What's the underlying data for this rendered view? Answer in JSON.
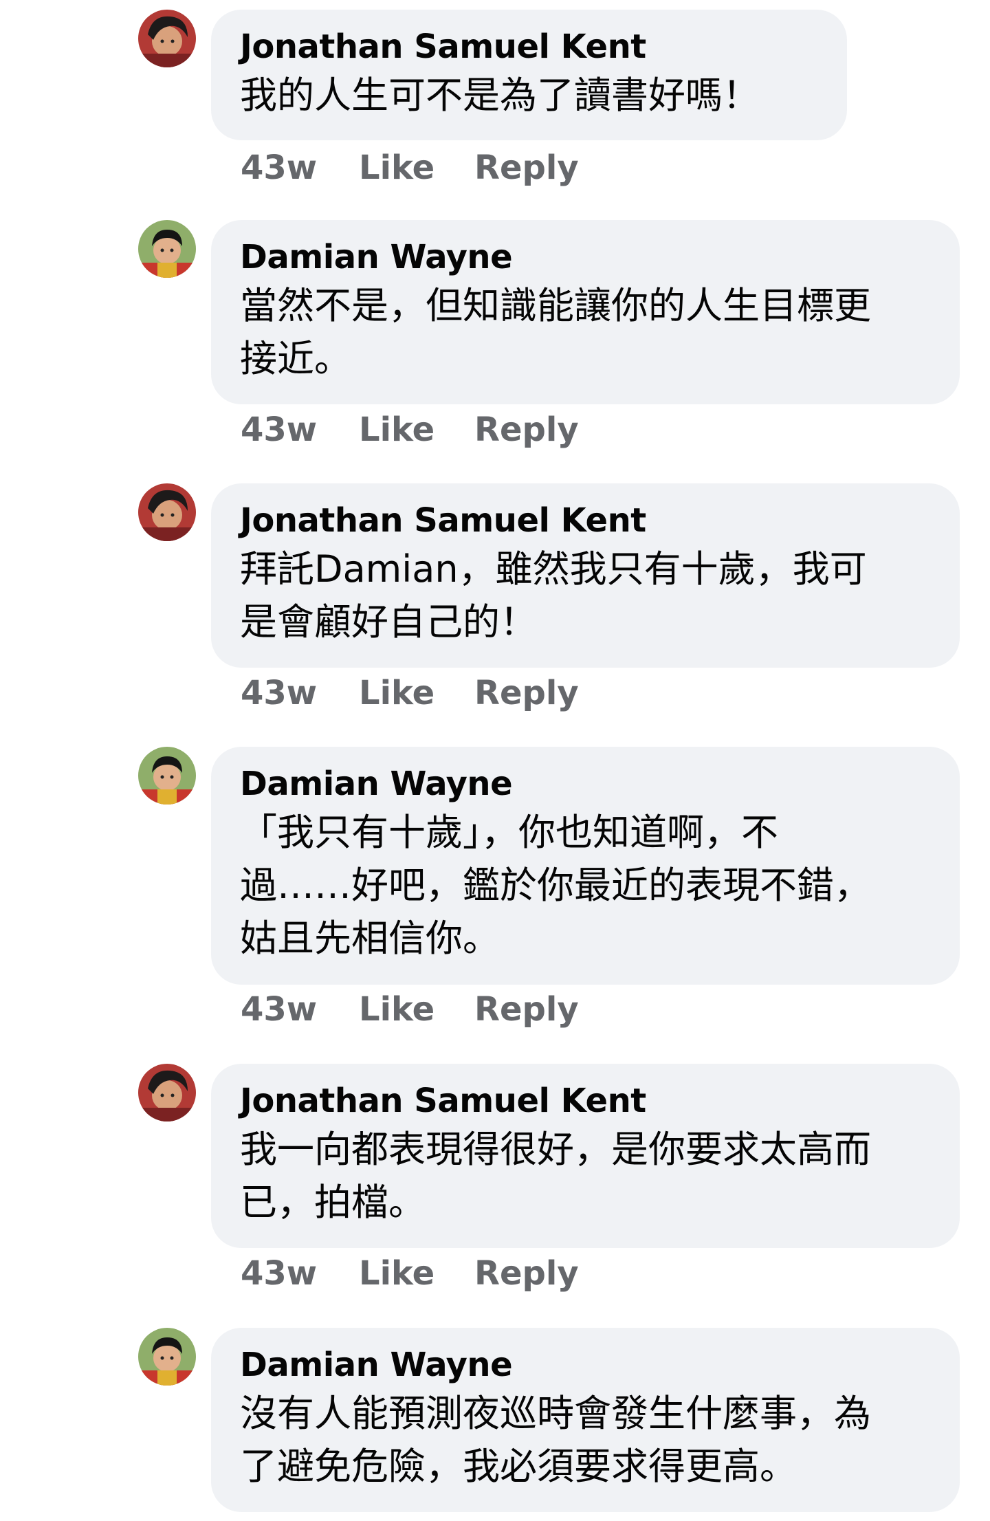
{
  "comments": [
    {
      "author": "Jonathan Samuel Kent",
      "avatar_icon": "jon-avatar-icon",
      "text": "我的人生可不是為了讀書好嗎！",
      "time": "43w",
      "like": "Like",
      "reply": "Reply"
    },
    {
      "author": "Damian Wayne",
      "avatar_icon": "damian-avatar-icon",
      "text": "當然不是，但知識能讓你的人生目標更\n接近。",
      "time": "43w",
      "like": "Like",
      "reply": "Reply"
    },
    {
      "author": "Jonathan Samuel Kent",
      "avatar_icon": "jon-avatar-icon",
      "text": "拜託Damian，雖然我只有十歲，我可\n是會顧好自己的！",
      "time": "43w",
      "like": "Like",
      "reply": "Reply"
    },
    {
      "author": "Damian Wayne",
      "avatar_icon": "damian-avatar-icon",
      "text": "「我只有十歲」，你也知道啊，不\n過……好吧，鑑於你最近的表現不錯，\n姑且先相信你。",
      "time": "43w",
      "like": "Like",
      "reply": "Reply"
    },
    {
      "author": "Jonathan Samuel Kent",
      "avatar_icon": "jon-avatar-icon",
      "text": "我一向都表現得很好，是你要求太高而\n已，拍檔。",
      "time": "43w",
      "like": "Like",
      "reply": "Reply"
    },
    {
      "author": "Damian Wayne",
      "avatar_icon": "damian-avatar-icon",
      "text": "沒有人能預測夜巡時會發生什麼事，為\n了避免危險，我必須要求得更高。",
      "time": "",
      "like": "",
      "reply": ""
    }
  ],
  "colors": {
    "bubble": "#f0f2f5",
    "author": "#050505",
    "meta": "#65676b"
  }
}
